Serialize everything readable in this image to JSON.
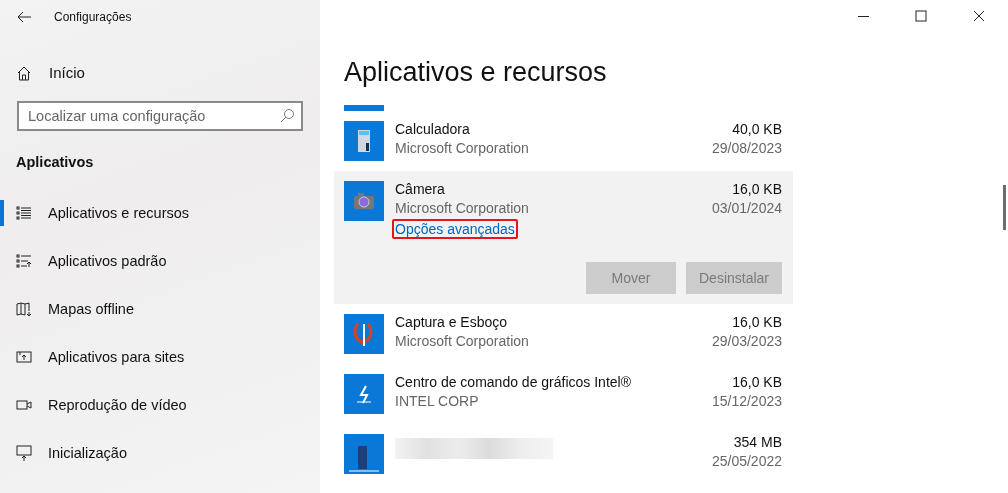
{
  "window": {
    "title": "Configurações"
  },
  "sidebar": {
    "home": "Início",
    "search": {
      "placeholder": "Localizar uma configuração"
    },
    "section": "Aplicativos",
    "items": [
      {
        "label": "Aplicativos e recursos",
        "selected": true
      },
      {
        "label": "Aplicativos padrão",
        "selected": false
      },
      {
        "label": "Mapas offline",
        "selected": false
      },
      {
        "label": "Aplicativos para sites",
        "selected": false
      },
      {
        "label": "Reprodução de vídeo",
        "selected": false
      },
      {
        "label": "Inicialização",
        "selected": false
      }
    ]
  },
  "content": {
    "title": "Aplicativos e recursos",
    "apps": [
      {
        "kind": "partial",
        "selected": false
      },
      {
        "kind": "app",
        "name": "Calculadora",
        "publisher": "Microsoft Corporation",
        "size": "40,0 KB",
        "date": "29/08/2023",
        "selected": false
      },
      {
        "kind": "app",
        "name": "Câmera",
        "publisher": "Microsoft Corporation",
        "size": "16,0 KB",
        "date": "03/01/2024",
        "selected": true,
        "link": {
          "label": "Opções avançadas",
          "highlighted": true
        },
        "buttons": [
          {
            "label": "Mover",
            "disabled": true
          },
          {
            "label": "Desinstalar",
            "disabled": true
          }
        ]
      },
      {
        "kind": "app",
        "name": "Captura e Esboço",
        "publisher": "Microsoft Corporation",
        "size": "16,0 KB",
        "date": "29/03/2023",
        "selected": false
      },
      {
        "kind": "app",
        "name": "Centro de comando de gráficos Intel®",
        "publisher": "INTEL CORP",
        "size": "16,0 KB",
        "date": "15/12/2023",
        "selected": false
      },
      {
        "kind": "blurred",
        "size": "354 MB",
        "date": "25/05/2022",
        "selected": false
      }
    ]
  }
}
